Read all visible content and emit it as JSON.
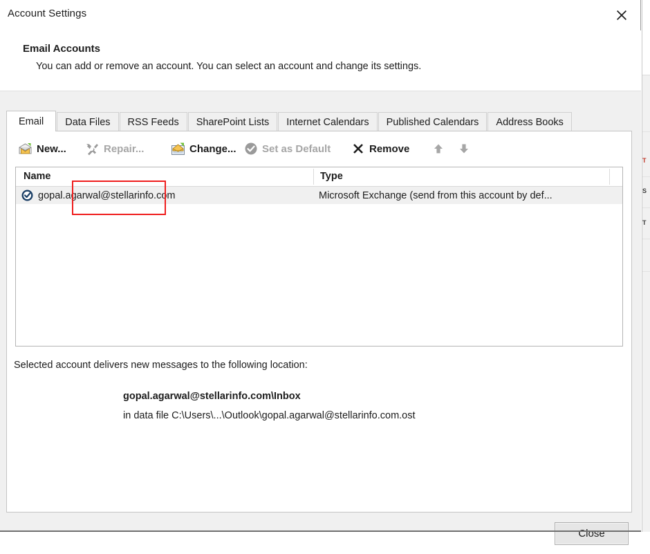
{
  "window": {
    "title": "Account Settings",
    "close_icon": "close-x-icon"
  },
  "header": {
    "title": "Email Accounts",
    "subtitle": "You can add or remove an account. You can select an account and change its settings."
  },
  "tabs": [
    {
      "label": "Email",
      "active": true
    },
    {
      "label": "Data Files",
      "active": false
    },
    {
      "label": "RSS Feeds",
      "active": false
    },
    {
      "label": "SharePoint Lists",
      "active": false
    },
    {
      "label": "Internet Calendars",
      "active": false
    },
    {
      "label": "Published Calendars",
      "active": false
    },
    {
      "label": "Address Books",
      "active": false
    }
  ],
  "toolbar": {
    "new_label": "New...",
    "new_icon": "new-mail-icon",
    "repair_label": "Repair...",
    "repair_icon": "wrench-screwdriver-icon",
    "change_label": "Change...",
    "change_icon": "change-account-icon",
    "set_default_label": "Set as Default",
    "set_default_icon": "check-circle-icon",
    "remove_label": "Remove",
    "remove_icon": "x-mark-icon",
    "move_up_icon": "arrow-up-icon",
    "move_down_icon": "arrow-down-icon"
  },
  "highlight": {
    "target": "repair-button",
    "color": "#ef1d1d"
  },
  "accounts_list": {
    "columns": [
      "Name",
      "Type"
    ],
    "rows": [
      {
        "icon": "exchange-account-icon",
        "name": "gopal.agarwal@stellarinfo.com",
        "type": "Microsoft Exchange (send from this account by def...",
        "selected": true
      }
    ]
  },
  "delivery_info": {
    "caption": "Selected account delivers new messages to the following location:",
    "location": "gopal.agarwal@stellarinfo.com\\Inbox",
    "data_file": "in data file C:\\Users\\...\\Outlook\\gopal.agarwal@stellarinfo.com.ost"
  },
  "footer": {
    "close_label": "Close"
  },
  "background_window": {
    "fragments": [
      "T",
      "S",
      "T"
    ]
  }
}
